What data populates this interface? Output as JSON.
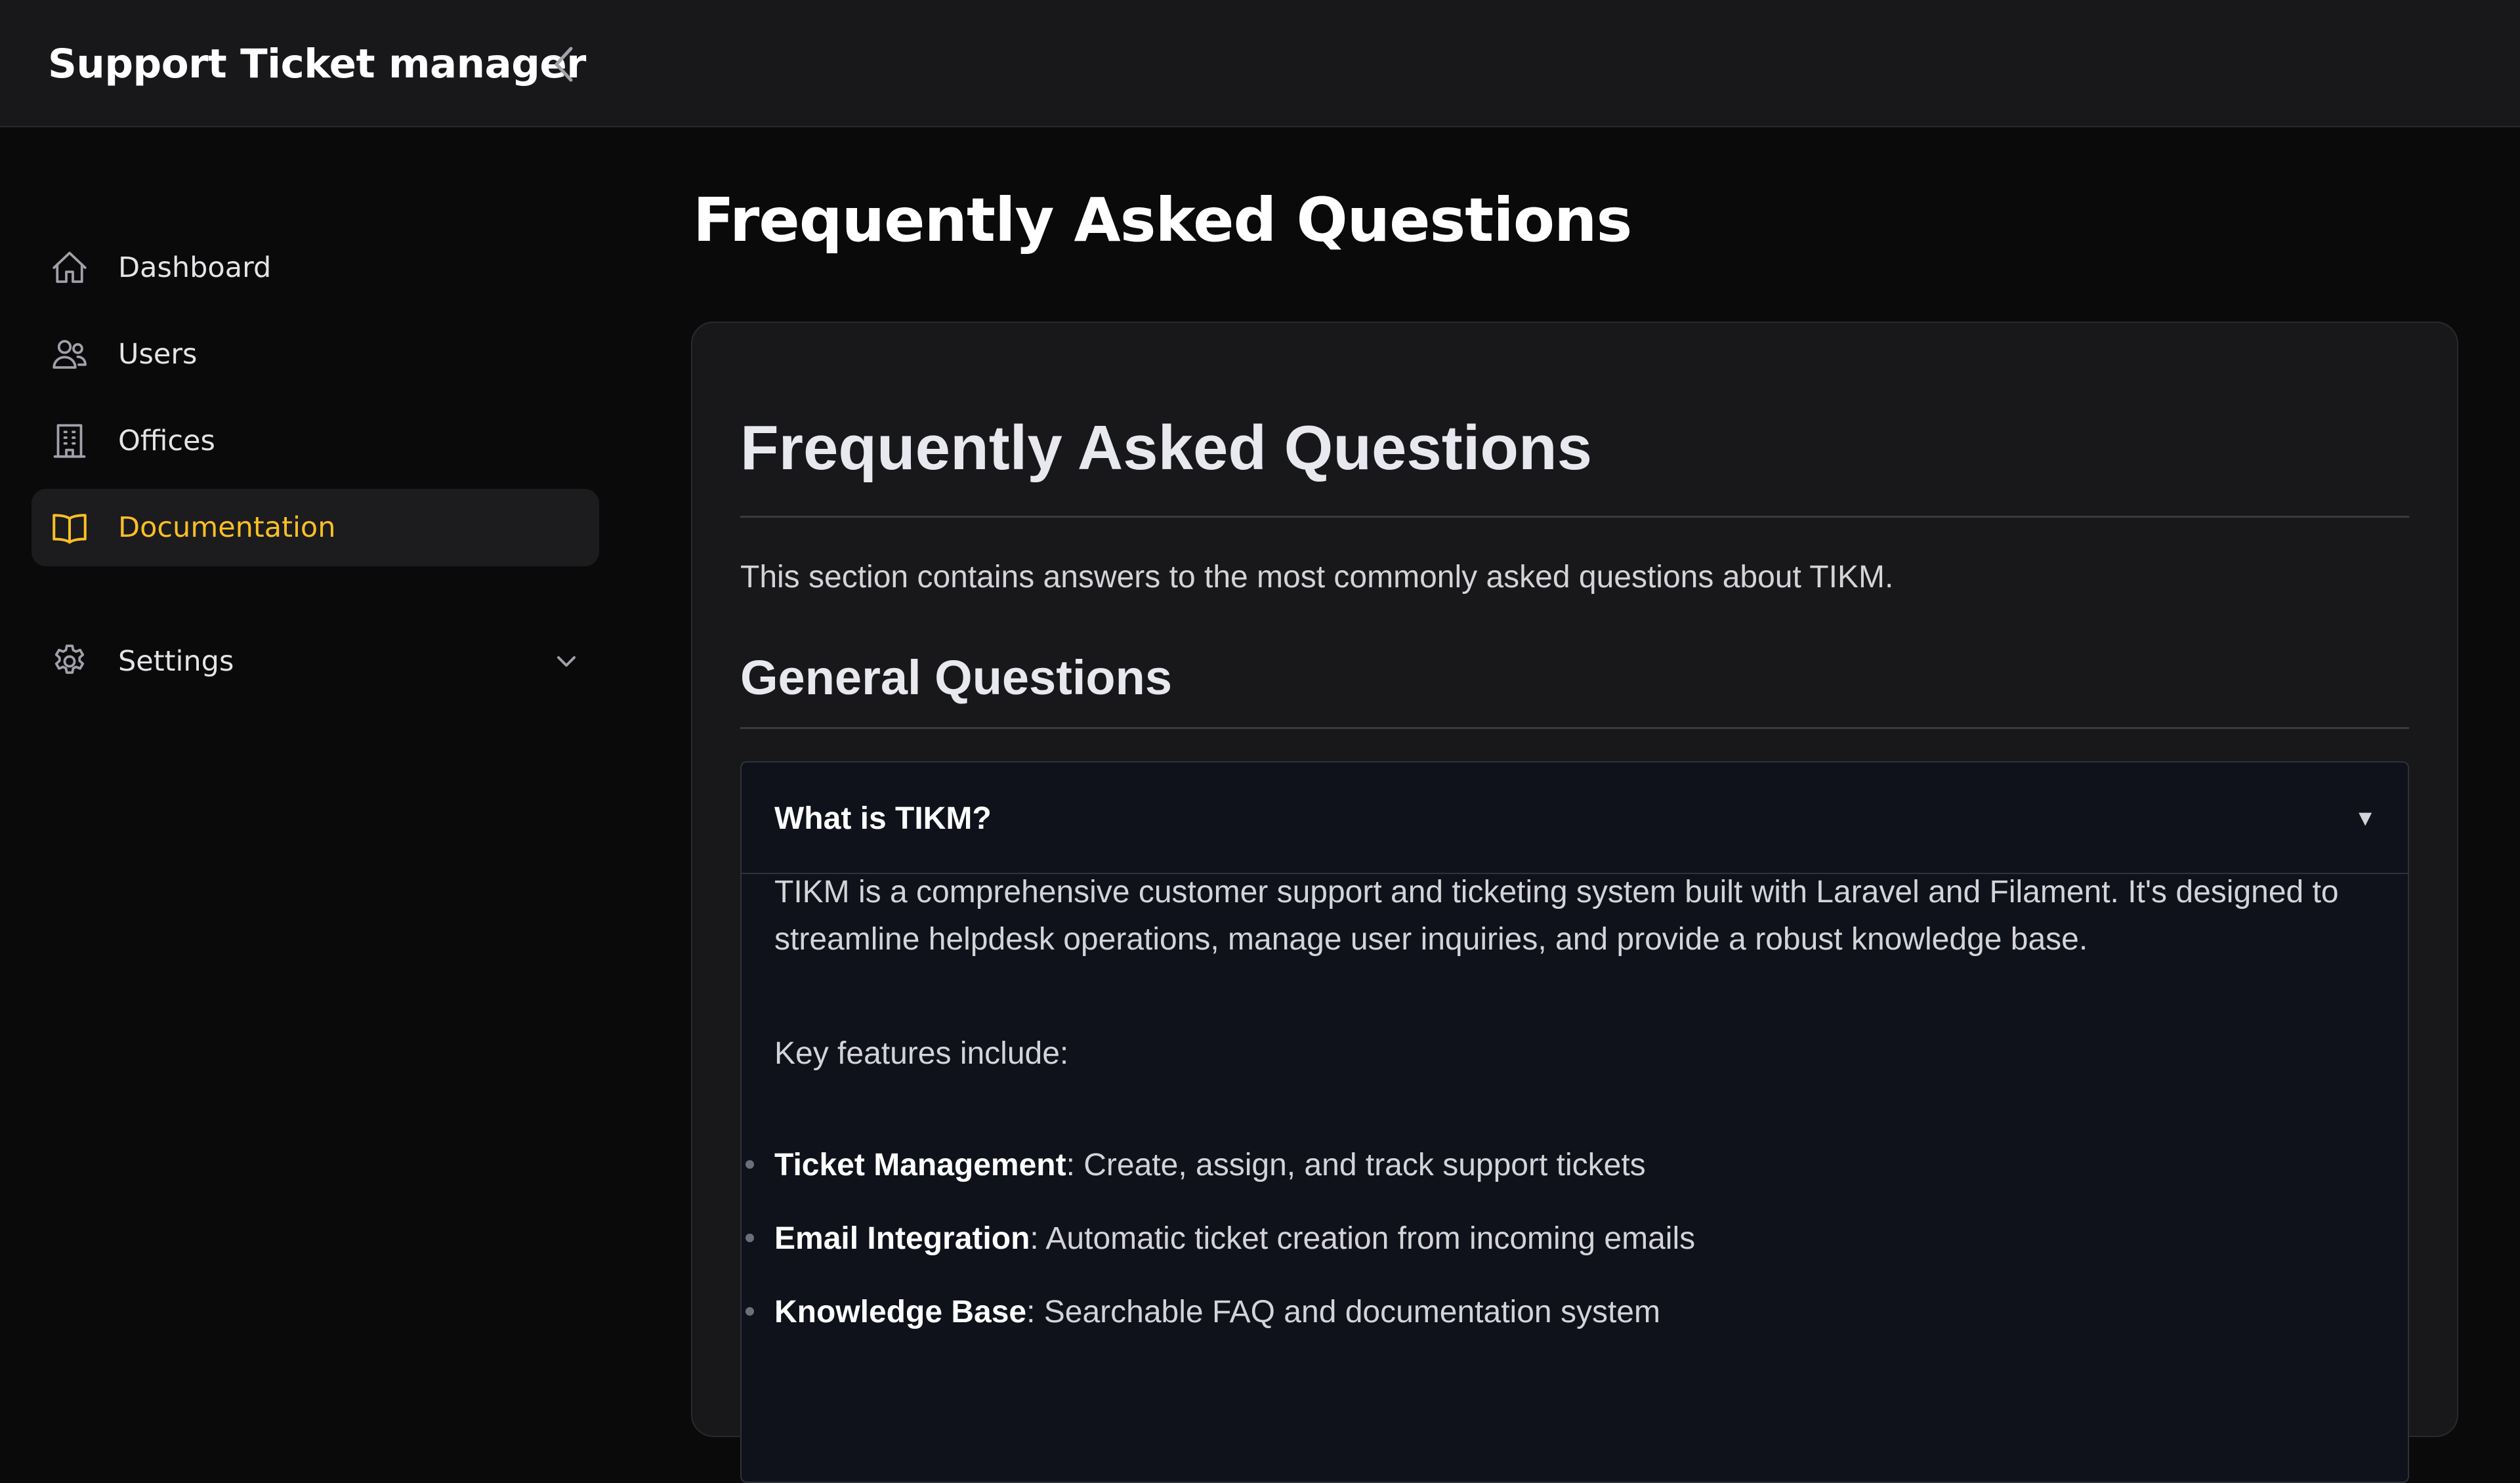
{
  "header": {
    "app_title": "Support Ticket manager"
  },
  "sidebar": {
    "items": [
      {
        "label": "Dashboard",
        "icon": "home-icon",
        "active": false
      },
      {
        "label": "Users",
        "icon": "users-icon",
        "active": false
      },
      {
        "label": "Offices",
        "icon": "building-icon",
        "active": false
      },
      {
        "label": "Documentation",
        "icon": "book-icon",
        "active": true
      }
    ],
    "settings": {
      "label": "Settings",
      "icon": "gear-icon"
    }
  },
  "main": {
    "page_title": "Frequently Asked Questions",
    "doc": {
      "title": "Frequently Asked Questions",
      "intro": "This section contains answers to the most commonly asked questions about TIKM.",
      "section_title": "General Questions",
      "faq": {
        "question": "What is TIKM?",
        "toggle": "▼",
        "answer": "TIKM is a comprehensive customer support and ticketing system built with Laravel and Filament. It's designed to streamline helpdesk operations, manage user inquiries, and provide a robust knowledge base.",
        "features_intro": "Key features include:",
        "features": [
          {
            "name": "Ticket Management",
            "desc": ": Create, assign, and track support tickets"
          },
          {
            "name": "Email Integration",
            "desc": ": Automatic ticket creation from incoming emails"
          },
          {
            "name": "Knowledge Base",
            "desc": ": Searchable FAQ and documentation system"
          }
        ]
      }
    }
  },
  "colors": {
    "accent": "#fbbf24",
    "background": "#0a0a0b",
    "card": "#18181b",
    "accordion": "#0f121a"
  }
}
